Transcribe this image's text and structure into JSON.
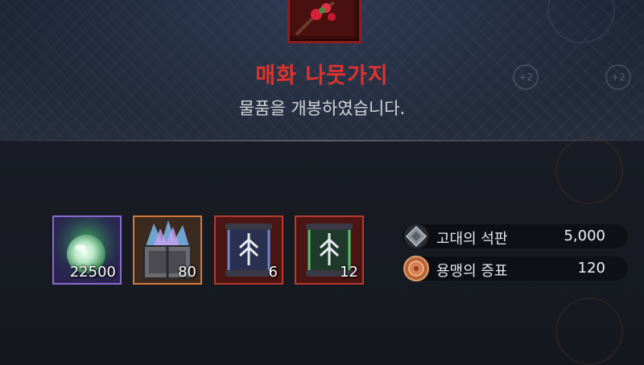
{
  "reward_popup": {
    "item_name": "매화 나뭇가지",
    "message": "물품을 개봉하였습니다."
  },
  "obtained_items": [
    {
      "name": "glowing-orb",
      "count": "22500",
      "grade_color": "#8a6ad0"
    },
    {
      "name": "crystal-chest",
      "count": "80",
      "grade_color": "#d47a3a"
    },
    {
      "name": "blue-scroll",
      "count": "6",
      "grade_color": "#b83a30"
    },
    {
      "name": "green-scroll",
      "count": "12",
      "grade_color": "#b83a30"
    }
  ],
  "currencies": [
    {
      "label": "고대의 석판",
      "value": "5,000",
      "icon": "stone-tablet-icon"
    },
    {
      "label": "용맹의 증표",
      "value": "120",
      "icon": "bronze-medal-icon"
    }
  ],
  "background_badges": [
    "+2",
    "+2"
  ]
}
